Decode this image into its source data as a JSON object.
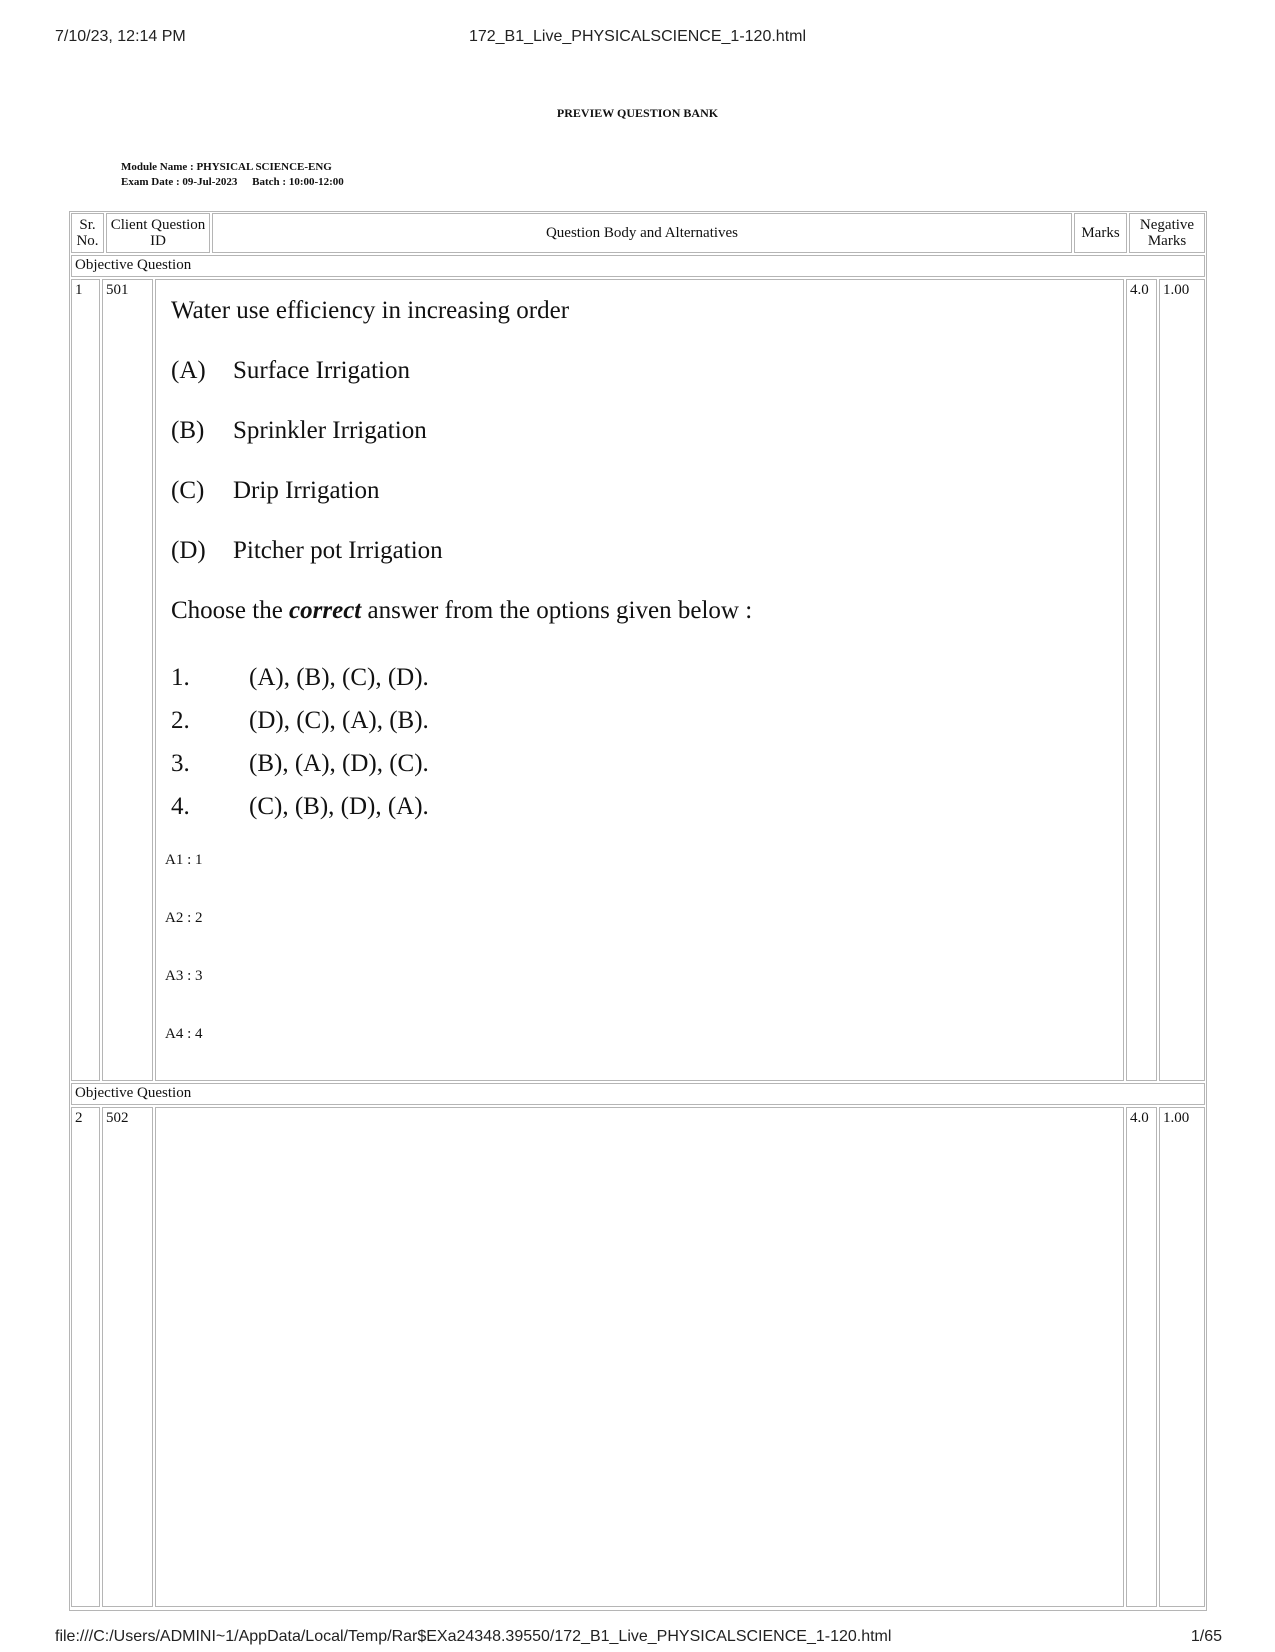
{
  "print_header": {
    "datetime": "7/10/23, 12:14 PM",
    "title": "172_B1_Live_PHYSICALSCIENCE_1-120.html"
  },
  "print_footer": {
    "url": "file:///C:/Users/ADMINI~1/AppData/Local/Temp/Rar$EXa24348.39550/172_B1_Live_PHYSICALSCIENCE_1-120.html",
    "page": "1/65"
  },
  "doc_title": "PREVIEW QUESTION BANK",
  "meta": {
    "module": "Module Name : PHYSICAL SCIENCE-ENG",
    "exam_date": "Exam Date : 09-Jul-2023",
    "batch": "Batch : 10:00-12:00"
  },
  "table": {
    "headers": {
      "sr_no": "Sr. No.",
      "client_qid": "Client Question ID",
      "body": "Question Body and Alternatives",
      "marks": "Marks",
      "negative": "Negative Marks"
    },
    "questions": [
      {
        "section": "Objective Question",
        "sr": "1",
        "id": "501",
        "marks": "4.0",
        "negative": "1.00",
        "stem": "Water use efficiency in increasing order",
        "options": [
          {
            "label": "(A)",
            "text": "Surface Irrigation"
          },
          {
            "label": "(B)",
            "text": "Sprinkler Irrigation"
          },
          {
            "label": "(C)",
            "text": "Drip Irrigation"
          },
          {
            "label": "(D)",
            "text": "Pitcher pot Irrigation"
          }
        ],
        "instruction_pre": "Choose the",
        "instruction_em": "correct",
        "instruction_post": "answer from the options given below :",
        "choices": [
          {
            "num": "1.",
            "text": "(A), (B), (C), (D)."
          },
          {
            "num": "2.",
            "text": "(D), (C), (A), (B)."
          },
          {
            "num": "3.",
            "text": "(B), (A), (D), (C)."
          },
          {
            "num": "4.",
            "text": "(C), (B), (D), (A)."
          }
        ],
        "answers": [
          "A1 : 1",
          "A2 : 2",
          "A3 : 3",
          "A4 : 4"
        ]
      },
      {
        "section": "Objective Question",
        "sr": "2",
        "id": "502",
        "marks": "4.0",
        "negative": "1.00"
      }
    ]
  }
}
